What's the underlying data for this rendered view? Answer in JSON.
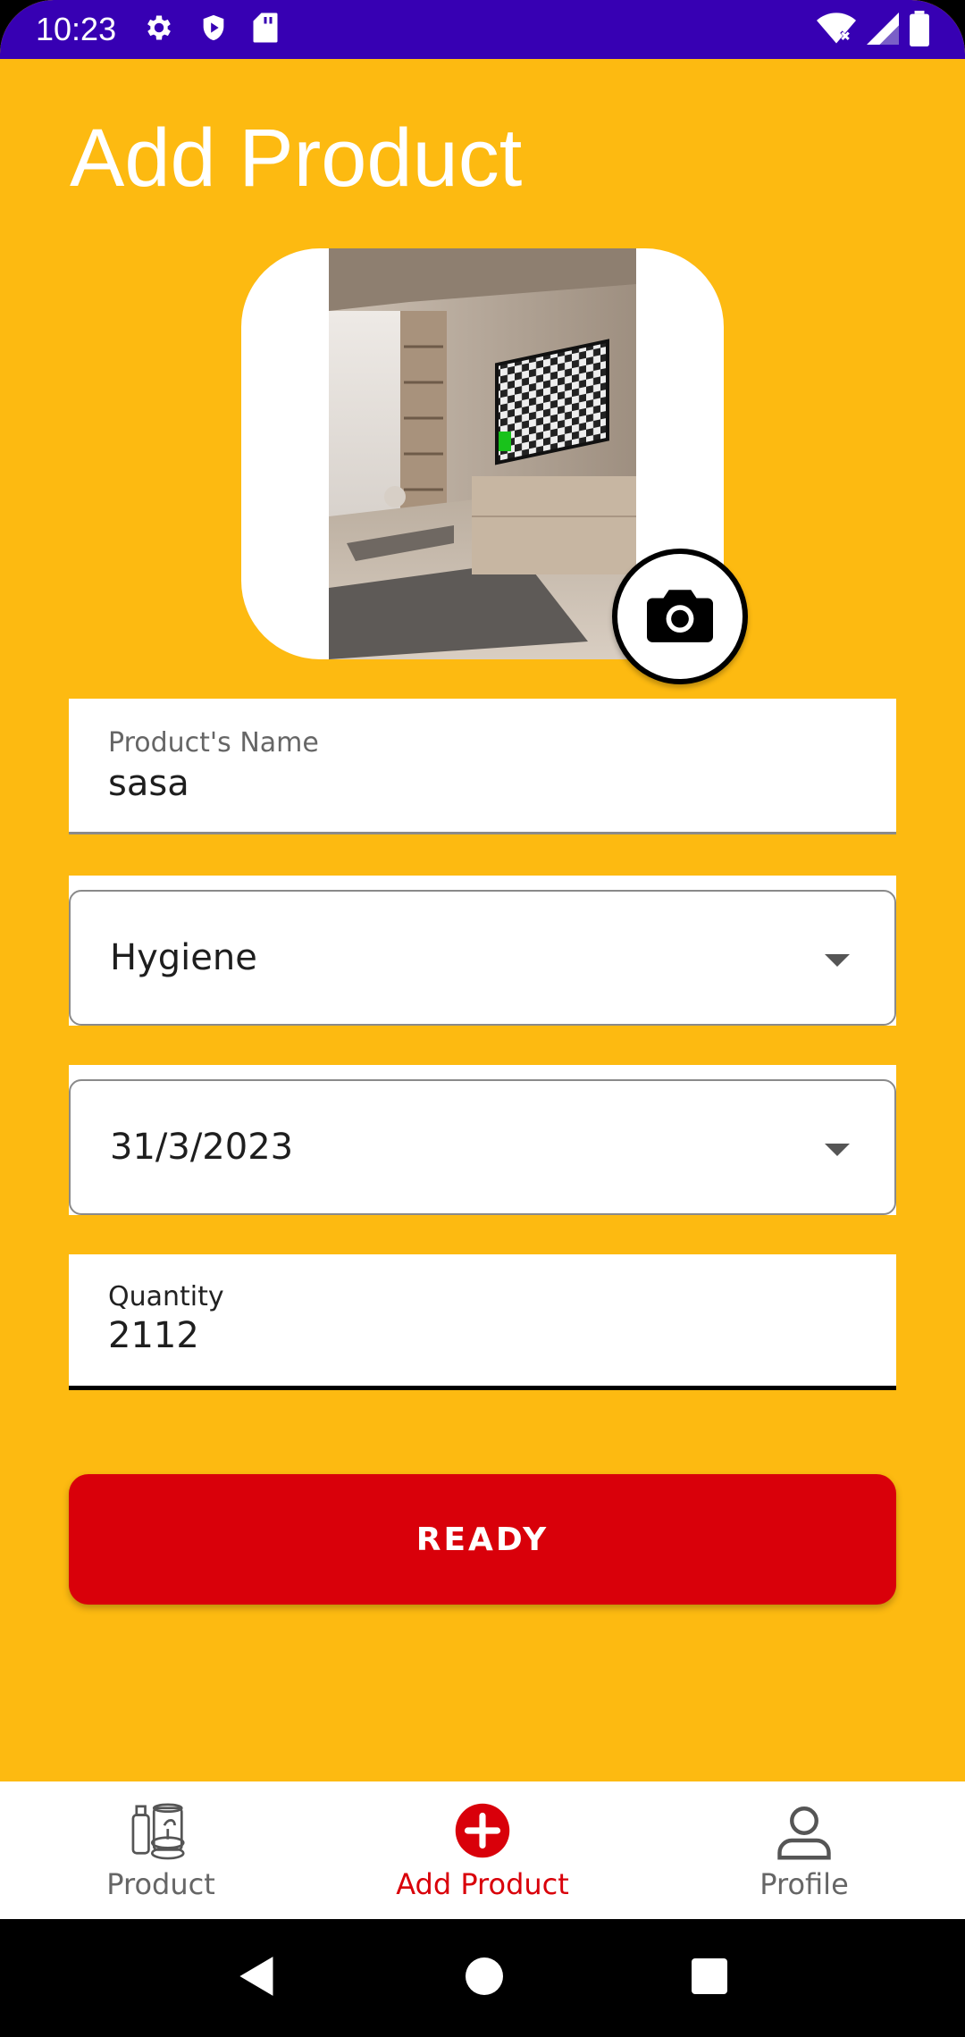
{
  "status_bar": {
    "time": "10:23",
    "bg_color": "#3700B3"
  },
  "page": {
    "title": "Add Product",
    "bg_color": "#FDBA11"
  },
  "image_card": {
    "camera_button_icon": "camera-icon"
  },
  "form": {
    "name_field": {
      "label": "Product's Name",
      "value": "sasa"
    },
    "category_select": {
      "value": "Hygiene"
    },
    "date_select": {
      "value": "31/3/2023"
    },
    "quantity_field": {
      "label": "Quantity",
      "value": "2112"
    },
    "ready_button": {
      "label": "READY",
      "color": "#D9000A"
    }
  },
  "bottom_nav": {
    "items": [
      {
        "label": "Product",
        "icon": "products-icon",
        "active": false
      },
      {
        "label": "Add Product",
        "icon": "add-circle-icon",
        "active": true
      },
      {
        "label": "Profile",
        "icon": "person-icon",
        "active": false
      }
    ]
  },
  "system_nav": {
    "icons": [
      "back-icon",
      "home-icon",
      "recents-icon"
    ]
  }
}
